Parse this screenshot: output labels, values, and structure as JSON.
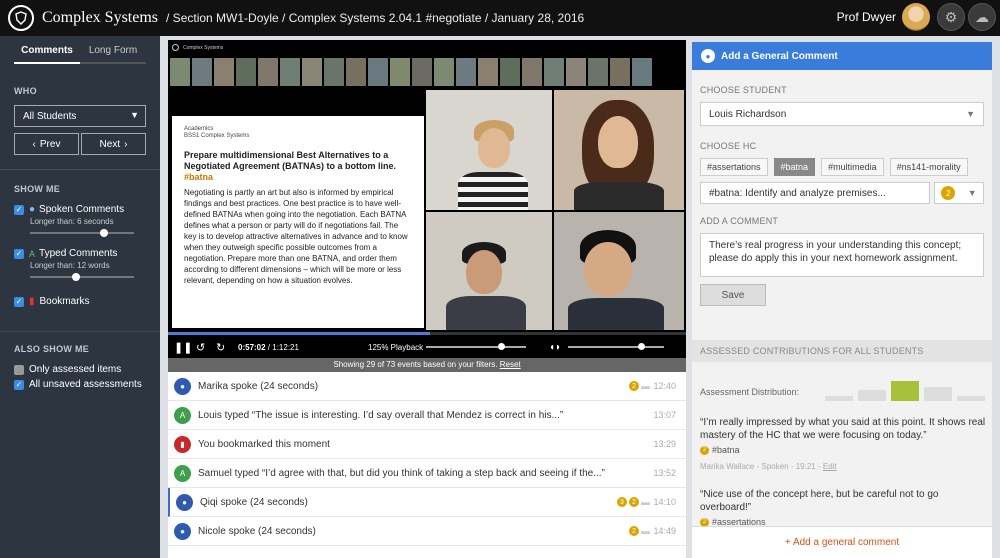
{
  "app": {
    "brand": "Complex Systems",
    "breadcrumb": "/ Section MW1-Doyle / Complex Systems 2.04.1 #negotiate / January 28, 2016",
    "user": "Prof Dwyer"
  },
  "sidebar": {
    "tabs": [
      "Comments",
      "Long Form"
    ],
    "who": "WHO",
    "student": "All Students",
    "prev": "Prev",
    "next": "Next",
    "show_me": "SHOW ME",
    "spoken": {
      "label": "Spoken Comments",
      "sub": "Longer than: 6 seconds",
      "level": 0.67
    },
    "typed": {
      "label": "Typed Comments",
      "sub": "Longer than: 12 words",
      "level": 0.4
    },
    "bookmarks": "Bookmarks",
    "also": "ALSO SHOW ME",
    "assessed_only": "Only assessed items",
    "unsaved": "All unsaved assessments"
  },
  "video": {
    "header": "Complex Systems",
    "slide": {
      "header1": "Academics",
      "header2": "BSS1 Complex Systems",
      "title": "Prepare multidimensional Best Alternatives to a Negotiated Agreement (BATNAs) to a bottom line.",
      "tag": "#batna",
      "body": "Negotiating is partly an art but also is informed by empirical findings and best practices. One best practice is to have well-defined BATNAs when going into the negotiation. Each BATNA defines what a person or party will do if negotiations fail. The key is to develop attractive alternatives in advance and to know when they outweigh specific possible outcomes from a negotiation. Prepare more than one BATNA, and order them according to different dimensions – which will be more or less relevant, depending on how a situation evolves."
    },
    "current": "0:57:02",
    "total": "1:12:21",
    "progress": 0.506,
    "playback": "125% Playback",
    "filter": "Showing 29 of 73 events based on your filters.",
    "reset": "Reset"
  },
  "events": [
    {
      "type": "spoke",
      "text": "Marika spoke (24 seconds)",
      "time": "12:40",
      "badges": [
        "2"
      ]
    },
    {
      "type": "typed",
      "text": "Louis typed  “The issue is interesting. I’d say overall that Mendez is correct in his...”",
      "time": "13:07",
      "badges": []
    },
    {
      "type": "book",
      "text": "You bookmarked this moment",
      "time": "13:29",
      "badges": []
    },
    {
      "type": "typed",
      "text": "Samuel typed “I’d agree with that, but did you think of taking a step back and seeing if the...”",
      "time": "13:52",
      "badges": []
    },
    {
      "type": "spoke",
      "text": "Qiqi spoke (24 seconds)",
      "time": "14:10",
      "badges": [
        "3",
        "2"
      ]
    },
    {
      "type": "spoke",
      "text": "Nicole spoke (24 seconds)",
      "time": "14:49",
      "badges": [
        "2"
      ]
    }
  ],
  "right": {
    "add_title": "Add a General Comment",
    "choose_student": "CHOOSE STUDENT",
    "student": "Louis Richardson",
    "choose_hc": "CHOOSE HC",
    "hc_tags": [
      "#assertations",
      "#batna",
      "#multimedia",
      "#ns141-morality"
    ],
    "hc_value": "#batna: Identify and analyze premises...",
    "score": "2",
    "add_comment": "ADD A COMMENT",
    "comment": "There’s real progress in your understanding this concept; please do apply this in your next homework assignment.",
    "save": "Save",
    "assessed_title": "ASSESSED CONTRIBUTIONS FOR ALL STUDENTS",
    "dist_label": "Assessment Distribution:",
    "dist": [
      0.2,
      0.45,
      0.85,
      0.6,
      0.2
    ],
    "quotes": [
      {
        "text": "“I’m really impressed by what you said at this point. It shows real mastery of the HC that we were focusing on today.”",
        "score": "2",
        "tag": "#batna",
        "meta": "Marika Wallace - Spoken - 19:21 -",
        "edit": "Edit"
      },
      {
        "text": "“Nice use of the concept here, but be careful not to go overboard!”",
        "score": "2",
        "tag": "#assertations"
      }
    ],
    "add_general": "+ Add a general comment"
  },
  "colors": {
    "accent": "#3a7cdb",
    "score": "#d9a500",
    "dist_active": "#a7c23a"
  }
}
